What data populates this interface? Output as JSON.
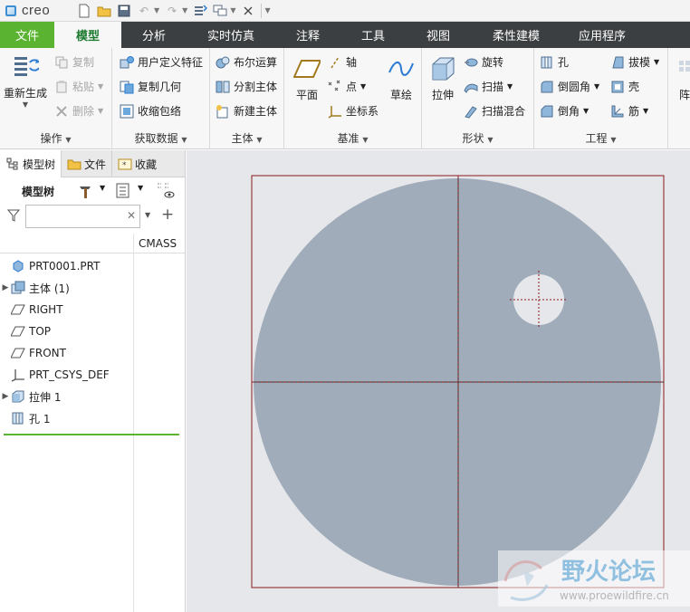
{
  "app": {
    "logo": "creo"
  },
  "quick_access": {
    "icons": [
      "new-file-icon",
      "open-folder-icon",
      "save-icon",
      "undo-icon",
      "redo-icon",
      "regenerate-icon",
      "windows-icon",
      "close-window-icon"
    ]
  },
  "tabs": [
    {
      "label": "文件"
    },
    {
      "label": "模型"
    },
    {
      "label": "分析"
    },
    {
      "label": "实时仿真"
    },
    {
      "label": "注释"
    },
    {
      "label": "工具"
    },
    {
      "label": "视图"
    },
    {
      "label": "柔性建模"
    },
    {
      "label": "应用程序"
    }
  ],
  "ribbon": {
    "operations": {
      "label": "操作",
      "regenerate": "重新生成",
      "copy": "复制",
      "paste": "粘贴",
      "delete": "删除"
    },
    "get_data": {
      "label": "获取数据",
      "udf": "用户定义特征",
      "copy_geom": "复制几何",
      "shrinkwrap": "收缩包络"
    },
    "body": {
      "label": "主体",
      "boolean": "布尔运算",
      "split": "分割主体",
      "new_body": "新建主体"
    },
    "datum": {
      "label": "基准",
      "plane": "平面",
      "axis": "轴",
      "point": "点",
      "csys": "坐标系",
      "sketch": "草绘"
    },
    "shapes": {
      "label": "形状",
      "extrude": "拉伸",
      "revolve": "旋转",
      "sweep": "扫描",
      "swept_blend": "扫描混合"
    },
    "engineering": {
      "label": "工程",
      "hole": "孔",
      "round": "倒圆角",
      "chamfer": "倒角",
      "draft": "拔模",
      "shell": "壳",
      "rib": "筋",
      "pattern_partial": "阵"
    }
  },
  "panel": {
    "tabs": [
      {
        "label": "模型树"
      },
      {
        "label": "文件"
      },
      {
        "label": "收藏"
      }
    ],
    "tree_label": "模型树",
    "filter_placeholder": "",
    "column_header": "CMASS",
    "items": [
      {
        "label": "PRT0001.PRT",
        "icon": "part-icon",
        "expandable": false
      },
      {
        "label": "主体 (1)",
        "icon": "body-icon",
        "expandable": true
      },
      {
        "label": "RIGHT",
        "icon": "datum-plane-icon",
        "expandable": false
      },
      {
        "label": "TOP",
        "icon": "datum-plane-icon",
        "expandable": false
      },
      {
        "label": "FRONT",
        "icon": "datum-plane-icon",
        "expandable": false
      },
      {
        "label": "PRT_CSYS_DEF",
        "icon": "csys-icon",
        "expandable": false
      },
      {
        "label": "拉伸 1",
        "icon": "extrude-icon",
        "expandable": true
      },
      {
        "label": "孔 1",
        "icon": "hole-icon",
        "expandable": false
      }
    ]
  },
  "colors": {
    "file_tab": "#5ab431",
    "tab_bar": "#3c3f41",
    "model_fill": "#a0acba",
    "graphics_bg": "#e6e7ea",
    "datum_line": "#8b1a1a"
  },
  "watermark": {
    "title": "野火论坛",
    "url": "www.proewildfire.cn"
  }
}
